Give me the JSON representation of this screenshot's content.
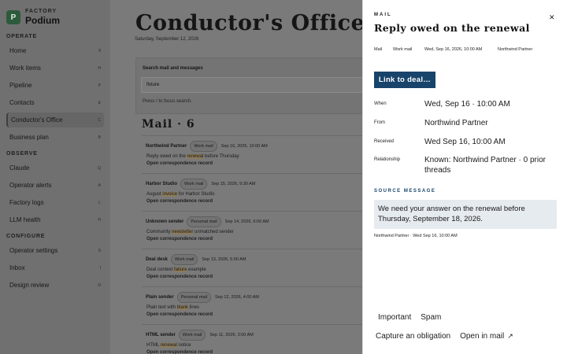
{
  "brand": {
    "logo_letter": "P",
    "subtitle": "FACTORY",
    "name": "Podium"
  },
  "sidebar": {
    "sections": [
      {
        "label": "OPERATE",
        "items": [
          {
            "label": "Home",
            "key": "8"
          },
          {
            "label": "Work items",
            "key": "H"
          },
          {
            "label": "Pipeline",
            "key": "P"
          },
          {
            "label": "Contacts",
            "key": "E"
          },
          {
            "label": "Conductor's Office",
            "key": "C",
            "active": true
          },
          {
            "label": "Business plan",
            "key": "B"
          }
        ]
      },
      {
        "label": "OBSERVE",
        "items": [
          {
            "label": "Claude",
            "key": "Q"
          },
          {
            "label": "Operator alerts",
            "key": "A"
          },
          {
            "label": "Factory logs",
            "key": "L"
          },
          {
            "label": "LLM health",
            "key": "H"
          }
        ]
      },
      {
        "label": "CONFIGURE",
        "items": [
          {
            "label": "Operator settings",
            "key": "S"
          },
          {
            "label": "Inbox",
            "key": "I"
          },
          {
            "label": "Design review",
            "key": "D"
          }
        ]
      }
    ]
  },
  "main": {
    "title": "Conductor's Office",
    "date": "Saturday, September 12, 2026",
    "search": {
      "label": "Search mail and messages",
      "value": "fixture",
      "hint": "Press / to focus search."
    },
    "mail_heading": "Mail · 6",
    "mail": [
      {
        "sender": "Northwind Partner",
        "chip": "Work mail",
        "date": "Sep 16, 2026, 10:00 AM",
        "subject_pre": "Reply owed on the ",
        "subject_hl": "renewal",
        "subject_post": " before Thursday",
        "open": "Open correspondence record"
      },
      {
        "sender": "Harbor Studio",
        "chip": "Work mail",
        "date": "Sep 15, 2026, 9:30 AM",
        "subject_pre": "August ",
        "subject_hl": "invoice",
        "subject_post": " for Harbor Studio",
        "open": "Open correspondence record"
      },
      {
        "sender": "Unknown sender",
        "chip": "Personal mail",
        "date": "Sep 14, 2026, 6:00 AM",
        "subject_pre": "Community ",
        "subject_hl": "newsletter",
        "subject_post": " unmatched sender",
        "open": "Open correspondence record"
      },
      {
        "sender": "Deal desk",
        "chip": "Work mail",
        "date": "Sep 13, 2026, 5:00 AM",
        "subject_pre": "Deal context ",
        "subject_hl": "failure",
        "subject_post": " example",
        "open": "Open correspondence record"
      },
      {
        "sender": "Plain sender",
        "chip": "Personal mail",
        "date": "Sep 12, 2026, 4:00 AM",
        "subject_pre": "Plain text with ",
        "subject_hl": "blank",
        "subject_post": " lines",
        "open": "Open correspondence record"
      },
      {
        "sender": "HTML sender",
        "chip": "Work mail",
        "date": "Sep 11, 2026, 3:00 AM",
        "subject_pre": "HTML ",
        "subject_hl": "renewal",
        "subject_post": " notice",
        "open": "Open correspondence record"
      }
    ]
  },
  "drawer": {
    "kicker": "MAIL",
    "title": "Reply owed on the renewal",
    "tags": [
      "Mail",
      "Work mail",
      "Wed, Sep 16, 2026, 10:00 AM",
      "Northwind Partner"
    ],
    "primary_button": "Link to deal…",
    "when": {
      "label": "When",
      "value": "Wed, Sep 16 · 10:00 AM"
    },
    "from": {
      "label": "From",
      "value": "Northwind Partner"
    },
    "received": {
      "label": "Received",
      "value": "Wed Sep 16, 10:00 AM"
    },
    "relationship": {
      "label": "Relationship",
      "value": "Known: Northwind Partner · 0 prior threads"
    },
    "source_label": "SOURCE MESSAGE",
    "source_text": "We need your answer on the renewal before Thursday, September 18, 2026.",
    "source_meta": "Northwind Partner · Wed Sep 16, 10:00 AM",
    "actions": {
      "important": "Important",
      "spam": "Spam",
      "capture": "Capture an obligation",
      "open_in_mail": "Open in mail"
    }
  },
  "colors": {
    "primary": "#18446b",
    "highlight": "#8c7a58",
    "source_bg": "#e6ebf0"
  }
}
